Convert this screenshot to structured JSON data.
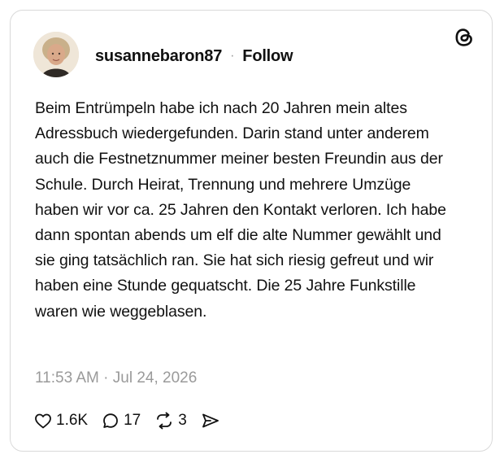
{
  "post": {
    "username": "susannebaron87",
    "separator": "·",
    "follow_label": "Follow",
    "text": "Beim Entrümpeln habe ich nach 20 Jahren mein altes Adressbuch wiedergefunden. Darin stand unter anderem auch die Festnetznummer meiner besten Freundin aus der Schule. Durch Heirat, Trennung und mehrere Umzüge haben wir vor ca. 25 Jahren den Kontakt verloren. Ich habe dann spontan abends um elf die alte Nummer gewählt und sie ging tatsächlich ran. Sie hat sich riesig gefreut und wir haben eine Stunde gequatscht. Die 25 Jahre Funkstille waren wie weggeblasen.",
    "timestamp": "11:53 AM · Jul 24, 2026"
  },
  "actions": {
    "likes": "1.6K",
    "replies": "17",
    "reposts": "3"
  },
  "icons": {
    "brand": "threads-logo-icon",
    "like": "heart-icon",
    "reply": "comment-bubble-icon",
    "repost": "repost-arrows-icon",
    "share": "send-arrow-icon"
  },
  "colors": {
    "text": "#111111",
    "muted": "#9a9a9a",
    "border": "#d9d9d9"
  }
}
